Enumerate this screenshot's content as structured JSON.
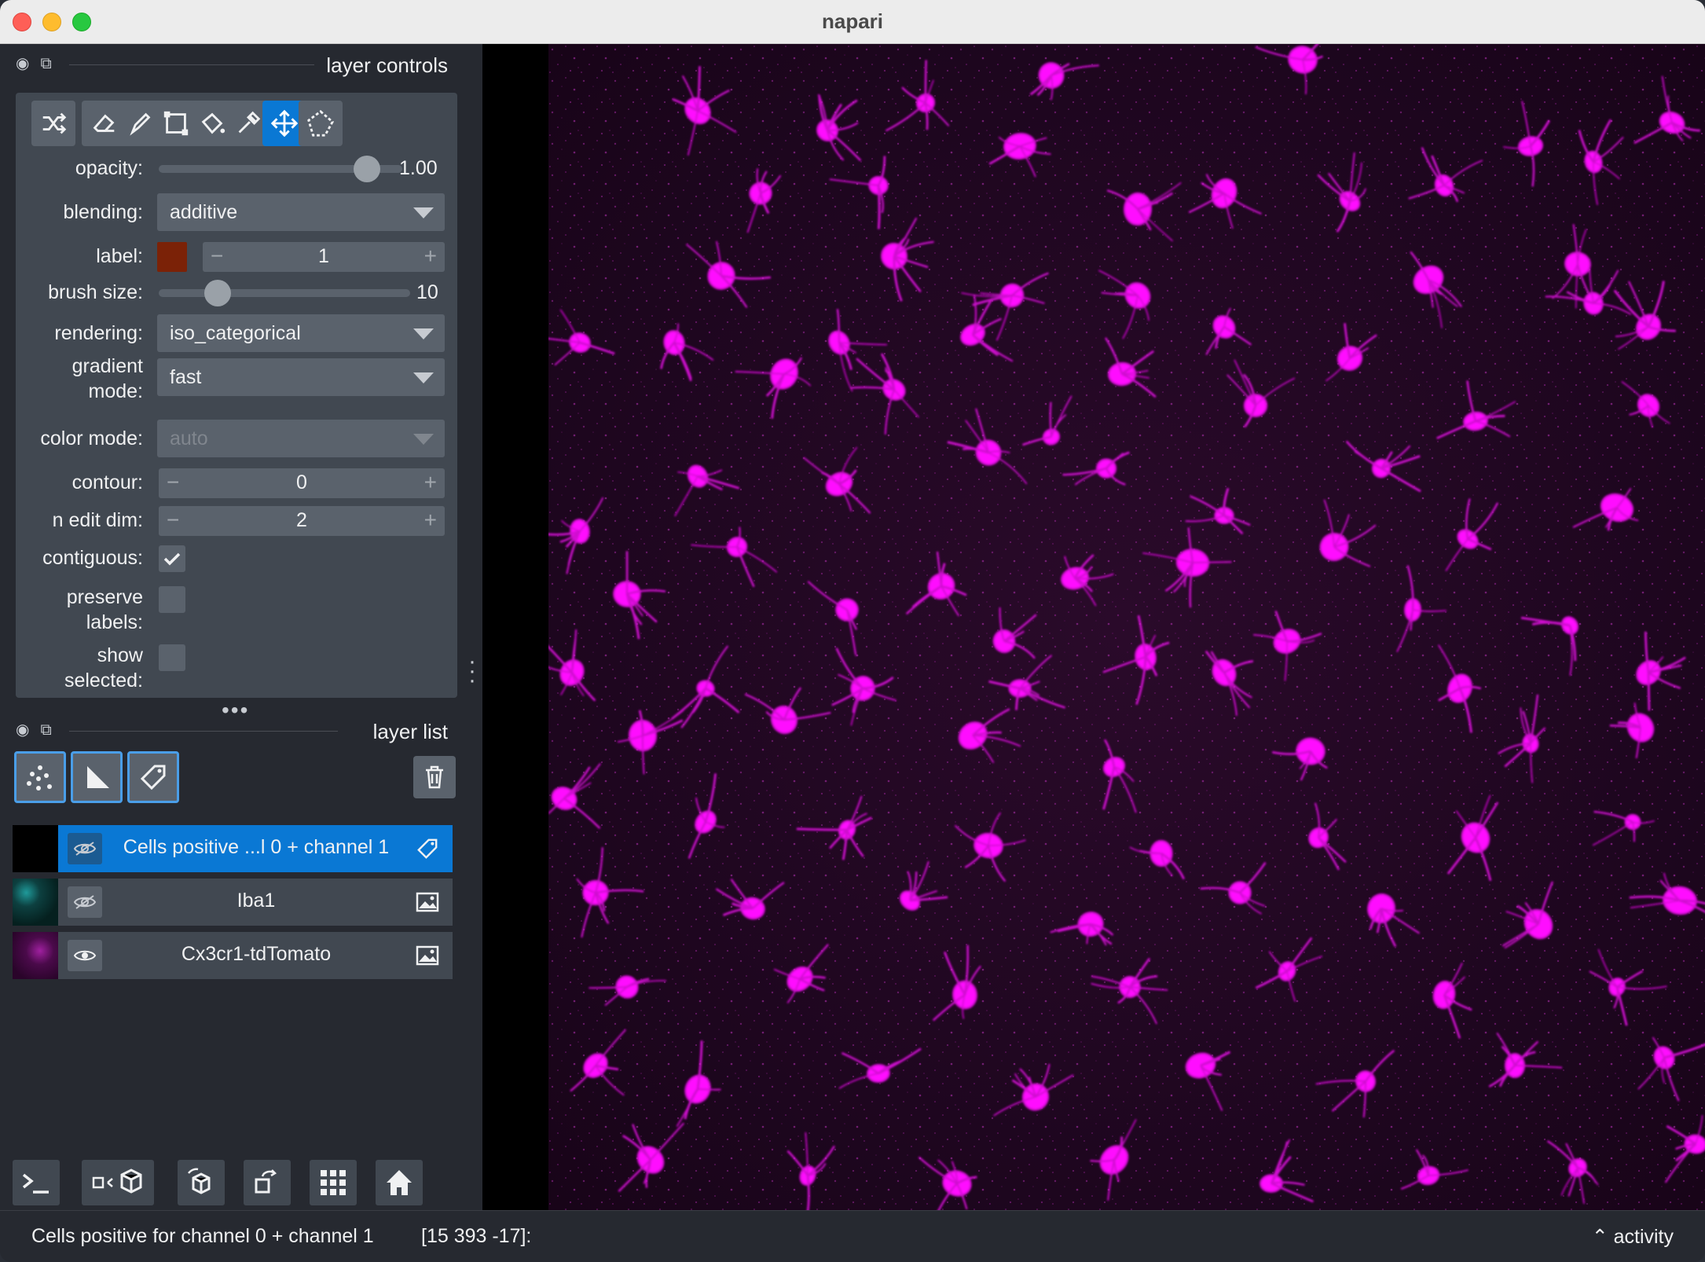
{
  "window": {
    "title": "napari"
  },
  "layer_controls": {
    "title": "layer controls",
    "opacity": {
      "label": "opacity:",
      "value": "1.00",
      "fraction": 1.0
    },
    "blending": {
      "label": "blending:",
      "value": "additive"
    },
    "label": {
      "label": "label:",
      "value": "1",
      "color": "#7b2207"
    },
    "brush_size": {
      "label": "brush size:",
      "value": "10",
      "fraction": 0.25
    },
    "rendering": {
      "label": "rendering:",
      "value": "iso_categorical"
    },
    "gradient_mode": {
      "label_line1": "gradient",
      "label_line2": "mode:",
      "value": "fast"
    },
    "color_mode": {
      "label": "color mode:",
      "value": "auto"
    },
    "contour": {
      "label": "contour:",
      "value": "0"
    },
    "n_edit_dim": {
      "label": "n edit dim:",
      "value": "2"
    },
    "contiguous": {
      "label": "contiguous:",
      "checked": true
    },
    "preserve_labels": {
      "label_line1": "preserve",
      "label_line2": "labels:",
      "checked": false
    },
    "show_selected": {
      "label_line1": "show",
      "label_line2": "selected:",
      "checked": false
    },
    "tools": [
      "shuffle-icon",
      "eraser-icon",
      "paint-brush-icon",
      "transform-icon",
      "fill-bucket-icon",
      "color-picker-icon",
      "pan-zoom-icon",
      "polygon-select-icon"
    ],
    "active_tool": "pan-zoom-icon"
  },
  "layer_list": {
    "title": "layer list",
    "layers": [
      {
        "name": "Cells positive ...l 0 + channel 1",
        "type_icon": "labels-icon",
        "selected": true,
        "visible": false
      },
      {
        "name": "Iba1",
        "type_icon": "image-icon",
        "selected": false,
        "visible": false
      },
      {
        "name": "Cx3cr1-tdTomato",
        "type_icon": "image-icon",
        "selected": false,
        "visible": true
      }
    ]
  },
  "status": {
    "layer_name": "Cells positive for channel 0 + channel 1",
    "coords": "[15 393 -17]:",
    "activity": "activity"
  },
  "colors": {
    "accent": "#0a78d4",
    "image_tint": "#ff00ff"
  }
}
